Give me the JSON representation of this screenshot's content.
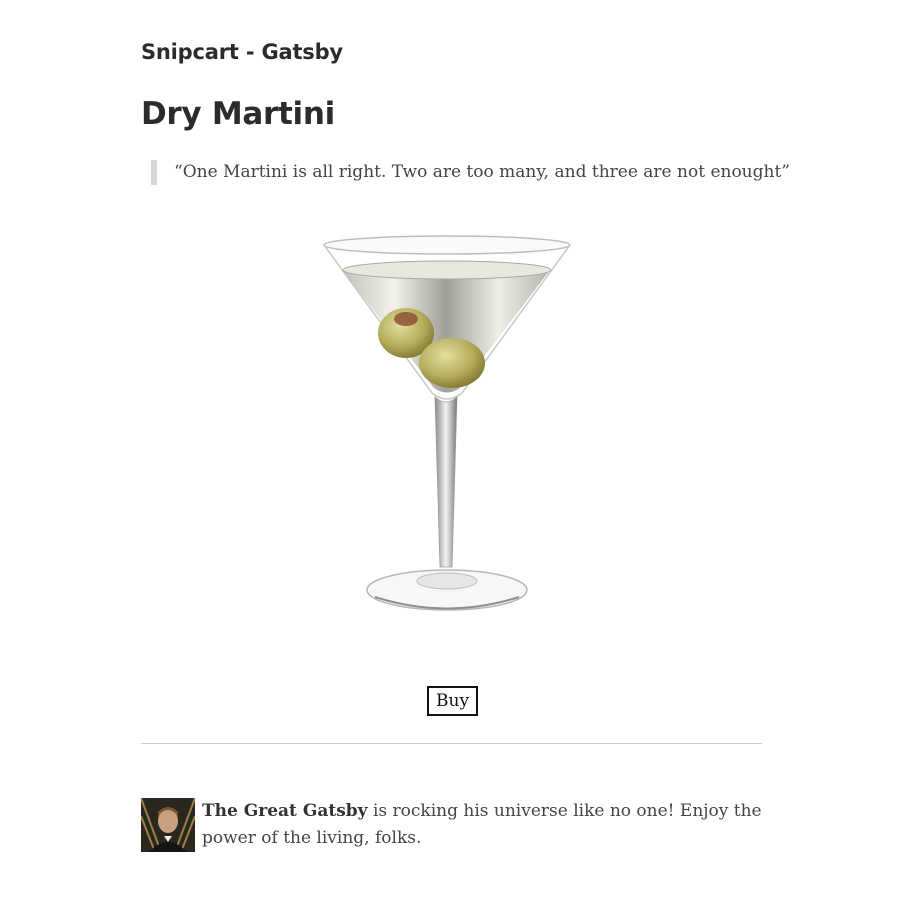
{
  "header": {
    "site_title": "Snipcart - Gatsby"
  },
  "post": {
    "title": "Dry Martini",
    "quote": "“One Martini is all right. Two are too many, and three are not enought”",
    "image_alt": "martini-glass-with-olives-image",
    "buy_label": "Buy"
  },
  "bio": {
    "author_name": "The Great Gatsby",
    "text": " is rocking his universe like no one! Enjoy the power of the living, folks."
  }
}
